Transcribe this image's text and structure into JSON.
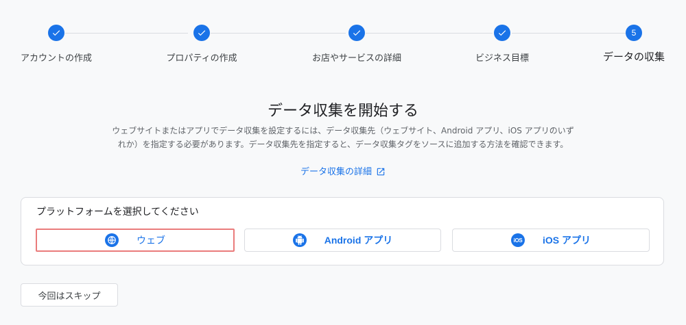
{
  "stepper": {
    "steps": [
      {
        "label": "アカウントの作成",
        "state": "done"
      },
      {
        "label": "プロパティの作成",
        "state": "done"
      },
      {
        "label": "お店やサービスの詳細",
        "state": "done"
      },
      {
        "label": "ビジネス目標",
        "state": "done"
      },
      {
        "label": "データの収集",
        "state": "current",
        "number": "5"
      }
    ]
  },
  "main": {
    "title": "データ収集を開始する",
    "description_line1": "ウェブサイトまたはアプリでデータ収集を設定するには、データ収集先（ウェブサイト、Android アプリ、iOS アプリのいず",
    "description_line2": "れか）を指定する必要があります。データ収集先を指定すると、データ収集タグをソースに追加する方法を確認できます。",
    "learn_more_link": "データ収集の詳細"
  },
  "platform_card": {
    "title": "プラットフォームを選択してください",
    "options": [
      {
        "label": "ウェブ",
        "icon": "globe-icon",
        "selected": true
      },
      {
        "label": "Android アプリ",
        "icon": "android-icon",
        "selected": false
      },
      {
        "label": "iOS アプリ",
        "icon": "ios-icon",
        "icon_text": "iOS",
        "selected": false
      }
    ]
  },
  "footer": {
    "skip_label": "今回はスキップ"
  },
  "colors": {
    "accent": "#1a73e8",
    "selected_outline": "#ea7b7b",
    "background": "#f8f9fa"
  }
}
